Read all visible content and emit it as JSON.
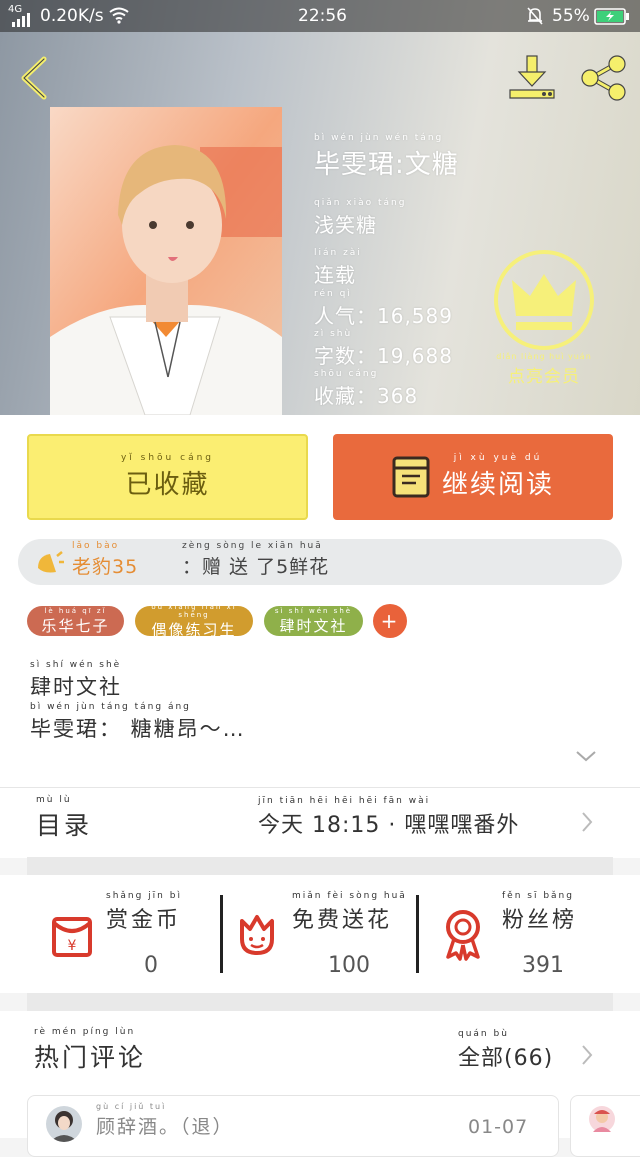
{
  "status_bar": {
    "signal": "4G",
    "speed": "0.20K/s",
    "time": "22:56",
    "battery": "55%"
  },
  "book": {
    "title_py": "bì  wén  jùn   wén  táng",
    "title": "毕雯珺:文糖",
    "author_py": "qiǎn xiào táng",
    "author": "浅笑糖",
    "status_py": "lián  zài",
    "status": "连载",
    "popularity_py": "rén  qì",
    "popularity_label": "人气：",
    "popularity": "16,589",
    "words_py": "zì  shù",
    "words_label": "字数：",
    "words": "19,688",
    "favorites_py": "shōu cáng",
    "favorites_label": "收藏：",
    "favorites": "368",
    "vip_py": "diǎn liàng huì yuán",
    "vip_label": "点亮会员"
  },
  "actions": {
    "fav_py": "yǐ  shōu cáng",
    "fav_label": "已收藏",
    "read_py": "jì   xù  yuè  dú",
    "read_label": "继续阅读"
  },
  "gift": {
    "user_py": "lǎo  bào",
    "user": "老豹35",
    "text_py": "zèng sòng  le      xiān huā",
    "text": "：赠 送 了5鲜花"
  },
  "tags": [
    {
      "py": "lè  huá  qī  zǐ",
      "label": "乐华七子",
      "color": "#cc6a52"
    },
    {
      "py": "ǒu xiàng liàn xí shēng",
      "label": "偶像练习生",
      "color": "#d19c2e"
    },
    {
      "py": "sì  shí  wén shè",
      "label": "肆时文社",
      "color": "#8fb04a"
    }
  ],
  "tag_add": "+",
  "intro": {
    "line1_py": "sì   shí  wén  shè",
    "line1": "肆时文社",
    "line2_py": "bì  wén  jùn        táng táng áng",
    "line2": "毕雯珺：  糖糖昂～…"
  },
  "toc": {
    "label_py": "mù   lù",
    "label": "目录",
    "latest_py": "jīn  tiān                   hēi   hēi   hēi  fān   wài",
    "latest": "今天 18:15 · 嘿嘿嘿番外"
  },
  "stats": [
    {
      "py": "shǎng jīn  bì",
      "label": "赏金币",
      "value": "0"
    },
    {
      "py": "miǎn  fèi  sòng  huā",
      "label": "免费送花",
      "value": "100"
    },
    {
      "py": "fěn   sī  bǎng",
      "label": "粉丝榜",
      "value": "391"
    }
  ],
  "comments": {
    "title_py": "rè   mén  píng  lùn",
    "title": "热门评论",
    "all_py": "quán  bù",
    "all": "全部(66)",
    "first_user_py": "gù   cí   jiǔ            tuì",
    "first_user": "顾辞酒。（退）",
    "first_date": "01-07"
  },
  "colors": {
    "accent_orange": "#e96a3d",
    "fav_yellow": "#fbee72",
    "vip_yellow": "#f6f07a",
    "red_icon": "#d83a2c"
  }
}
